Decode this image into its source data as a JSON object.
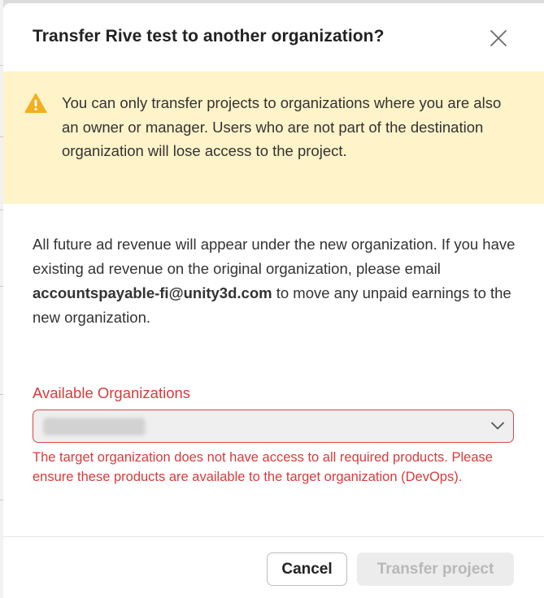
{
  "dialog": {
    "title": "Transfer Rive test to another organization?",
    "close_icon": "close-x-icon"
  },
  "warning": {
    "icon": "warning-triangle-icon",
    "text": "You can only transfer projects to organizations where you are also an owner or manager. Users who are not part of the destination organization will lose access to the project."
  },
  "body": {
    "part1": "All future ad revenue will appear under the new organization. If you have existing ad revenue on the original organization, please email ",
    "email": "accountspayable-fi@unity3d.com",
    "part2": " to move any unpaid earnings to the new organization."
  },
  "organizations": {
    "label": "Available Organizations",
    "selected_value": "",
    "chevron_icon": "chevron-down-icon",
    "error": "The target organization does not have access to all required products. Please ensure these products are available to the target organization (DevOps)."
  },
  "footer": {
    "cancel_label": "Cancel",
    "transfer_label": "Transfer project"
  },
  "colors": {
    "warning_bg": "#fff3c9",
    "warning_icon": "#f2b01e",
    "error": "#d83b3b",
    "disabled_button_bg": "#ececec"
  }
}
